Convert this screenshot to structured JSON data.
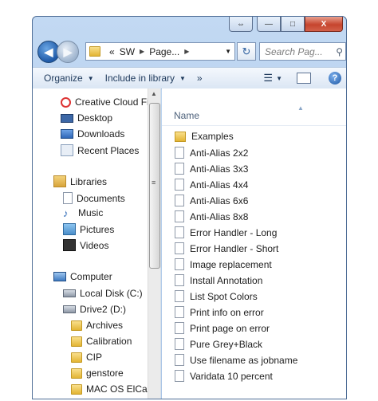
{
  "window": {
    "caption": {
      "minimize": "—",
      "maximize": "□",
      "close": "X",
      "restore": "⇔"
    }
  },
  "nav": {
    "back_icon": "back-arrow-icon",
    "forward_icon": "forward-arrow-icon",
    "breadcrumb": [
      "«",
      "SW",
      "Page..."
    ],
    "refresh_icon": "refresh-icon",
    "search_placeholder": "Search Pag..."
  },
  "toolbar": {
    "organize": "Organize",
    "include_in_library": "Include in library",
    "more": "»"
  },
  "sidebar": {
    "items": [
      {
        "label": "Creative Cloud Fi",
        "icon": "creative-cloud-icon"
      },
      {
        "label": "Desktop",
        "icon": "desktop-icon"
      },
      {
        "label": "Downloads",
        "icon": "downloads-icon"
      },
      {
        "label": "Recent Places",
        "icon": "recent-places-icon"
      },
      {
        "label": "Libraries",
        "icon": "libraries-icon"
      },
      {
        "label": "Documents",
        "icon": "documents-icon"
      },
      {
        "label": "Music",
        "icon": "music-icon"
      },
      {
        "label": "Pictures",
        "icon": "pictures-icon"
      },
      {
        "label": "Videos",
        "icon": "videos-icon"
      },
      {
        "label": "Computer",
        "icon": "computer-icon"
      },
      {
        "label": "Local Disk (C:)",
        "icon": "local-disk-icon"
      },
      {
        "label": "Drive2 (D:)",
        "icon": "drive-icon"
      },
      {
        "label": "Archives",
        "icon": "folder-icon"
      },
      {
        "label": "Calibration",
        "icon": "folder-icon"
      },
      {
        "label": "CIP",
        "icon": "folder-icon"
      },
      {
        "label": "genstore",
        "icon": "folder-icon"
      },
      {
        "label": "MAC OS ElCapi",
        "icon": "folder-icon"
      }
    ]
  },
  "files": {
    "column_header": "Name",
    "items": [
      {
        "label": "Examples",
        "type": "folder"
      },
      {
        "label": "Anti-Alias 2x2",
        "type": "file"
      },
      {
        "label": "Anti-Alias 3x3",
        "type": "file"
      },
      {
        "label": "Anti-Alias 4x4",
        "type": "file"
      },
      {
        "label": "Anti-Alias 6x6",
        "type": "file"
      },
      {
        "label": "Anti-Alias 8x8",
        "type": "file"
      },
      {
        "label": "Error Handler - Long",
        "type": "file"
      },
      {
        "label": "Error Handler - Short",
        "type": "file"
      },
      {
        "label": "Image replacement",
        "type": "file"
      },
      {
        "label": "Install Annotation",
        "type": "file"
      },
      {
        "label": "List Spot Colors",
        "type": "file"
      },
      {
        "label": "Print info on error",
        "type": "file"
      },
      {
        "label": "Print page on error",
        "type": "file"
      },
      {
        "label": "Pure Grey+Black",
        "type": "file"
      },
      {
        "label": "Use filename as jobname",
        "type": "file"
      },
      {
        "label": "Varidata 10 percent",
        "type": "file"
      }
    ]
  }
}
